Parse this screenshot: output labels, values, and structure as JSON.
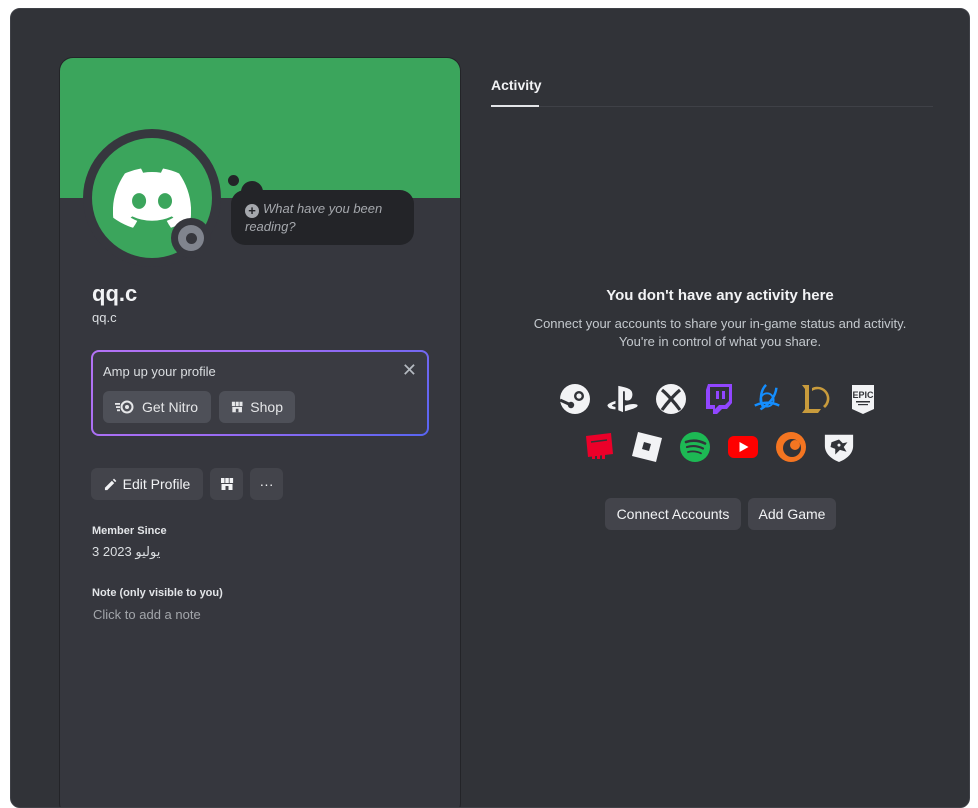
{
  "profile": {
    "display_name": "qq.c",
    "username": "qq.c",
    "status_placeholder": "What have you been reading?",
    "banner_color": "#3ba55c",
    "status_color": "#80848e"
  },
  "nitro_promo": {
    "title": "Amp up your profile",
    "get_nitro_label": "Get Nitro",
    "shop_label": "Shop"
  },
  "actions": {
    "edit_profile_label": "Edit Profile",
    "more_label": "···"
  },
  "member_since": {
    "label": "Member Since",
    "value": "3 يوليو 2023"
  },
  "note": {
    "label": "Note (only visible to you)",
    "placeholder": "Click to add a note"
  },
  "activity": {
    "tab_label": "Activity",
    "empty_title": "You don't have any activity here",
    "empty_description": "Connect your accounts to share your in-game status and activity. You're in control of what you share.",
    "services_row1": [
      "steam-icon",
      "playstation-icon",
      "xbox-icon",
      "twitch-icon",
      "battlenet-icon",
      "league-of-legends-icon",
      "epic-games-icon"
    ],
    "services_row2": [
      "riot-games-icon",
      "roblox-icon",
      "spotify-icon",
      "youtube-icon",
      "crunchyroll-icon",
      "bungie-icon"
    ],
    "epic_label": "EPIC",
    "connect_accounts_label": "Connect Accounts",
    "add_game_label": "Add Game"
  }
}
